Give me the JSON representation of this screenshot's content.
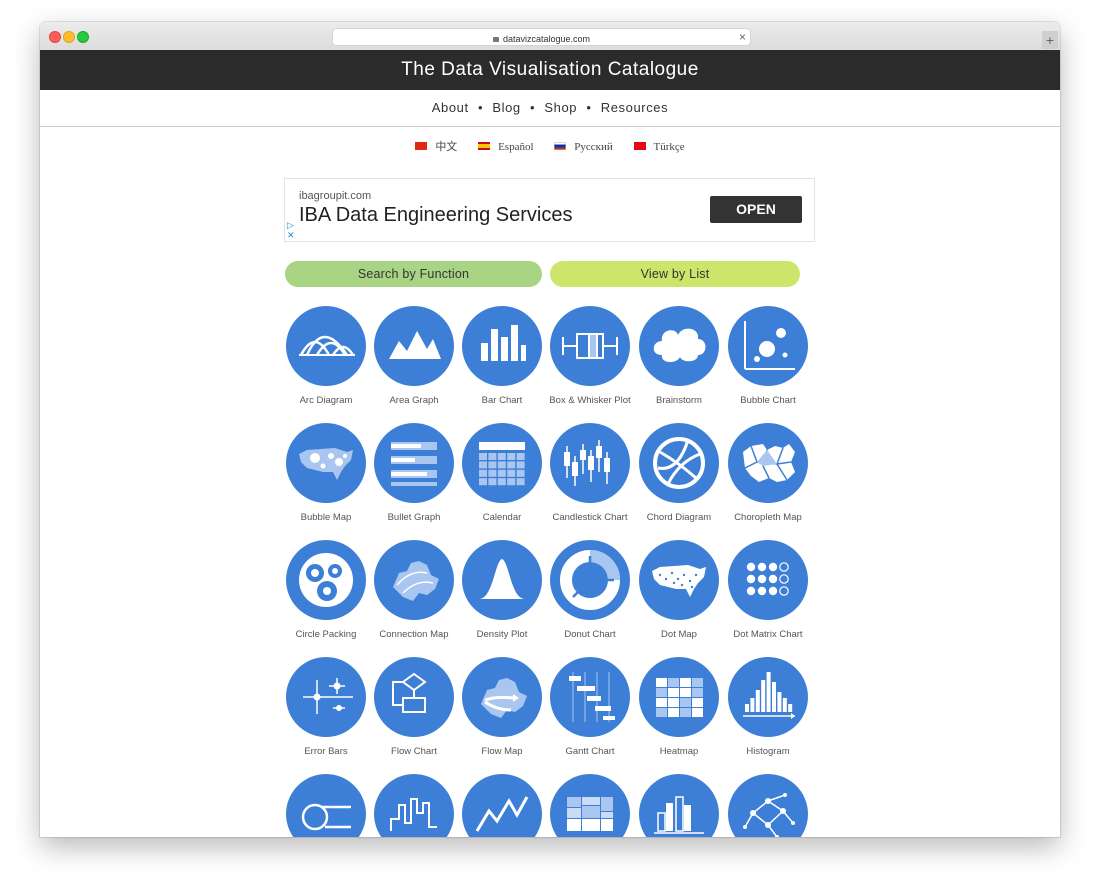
{
  "browser": {
    "url": "datavizcatalogue.com"
  },
  "site": {
    "title": "The Data Visualisation Catalogue"
  },
  "nav": {
    "items": [
      "About",
      "Blog",
      "Shop",
      "Resources"
    ],
    "separator": "•"
  },
  "languages": [
    {
      "label": "中文"
    },
    {
      "label": "Español"
    },
    {
      "label": "Русский"
    },
    {
      "label": "Türkçe"
    }
  ],
  "ad": {
    "domain": "ibagroupit.com",
    "headline": "IBA Data Engineering Services",
    "cta": "OPEN"
  },
  "buttons": {
    "function": "Search by Function",
    "list": "View by List"
  },
  "colors": {
    "tile": "#3d7fd6",
    "topbar": "#2b2b2b",
    "function_button": "#a9d483",
    "list_button": "#cde56a"
  },
  "catalogue": [
    {
      "label": "Arc Diagram",
      "icon": "arc-diagram-icon"
    },
    {
      "label": "Area Graph",
      "icon": "area-graph-icon"
    },
    {
      "label": "Bar Chart",
      "icon": "bar-chart-icon"
    },
    {
      "label": "Box & Whisker Plot",
      "icon": "box-whisker-icon"
    },
    {
      "label": "Brainstorm",
      "icon": "brainstorm-icon"
    },
    {
      "label": "Bubble Chart",
      "icon": "bubble-chart-icon"
    },
    {
      "label": "Bubble Map",
      "icon": "bubble-map-icon"
    },
    {
      "label": "Bullet Graph",
      "icon": "bullet-graph-icon"
    },
    {
      "label": "Calendar",
      "icon": "calendar-icon"
    },
    {
      "label": "Candlestick Chart",
      "icon": "candlestick-chart-icon"
    },
    {
      "label": "Chord Diagram",
      "icon": "chord-diagram-icon"
    },
    {
      "label": "Choropleth Map",
      "icon": "choropleth-map-icon"
    },
    {
      "label": "Circle Packing",
      "icon": "circle-packing-icon"
    },
    {
      "label": "Connection Map",
      "icon": "connection-map-icon"
    },
    {
      "label": "Density Plot",
      "icon": "density-plot-icon"
    },
    {
      "label": "Donut Chart",
      "icon": "donut-chart-icon"
    },
    {
      "label": "Dot Map",
      "icon": "dot-map-icon"
    },
    {
      "label": "Dot Matrix Chart",
      "icon": "dot-matrix-chart-icon"
    },
    {
      "label": "Error Bars",
      "icon": "error-bars-icon"
    },
    {
      "label": "Flow Chart",
      "icon": "flow-chart-icon"
    },
    {
      "label": "Flow Map",
      "icon": "flow-map-icon"
    },
    {
      "label": "Gantt Chart",
      "icon": "gantt-chart-icon"
    },
    {
      "label": "Heatmap",
      "icon": "heatmap-icon"
    },
    {
      "label": "Histogram",
      "icon": "histogram-icon"
    },
    {
      "label": "",
      "icon": "illustration-diagram-icon"
    },
    {
      "label": "",
      "icon": "kagi-chart-icon"
    },
    {
      "label": "",
      "icon": "line-graph-icon"
    },
    {
      "label": "",
      "icon": "marimekko-chart-icon"
    },
    {
      "label": "",
      "icon": "multi-set-bar-chart-icon"
    },
    {
      "label": "",
      "icon": "network-diagram-icon"
    }
  ]
}
